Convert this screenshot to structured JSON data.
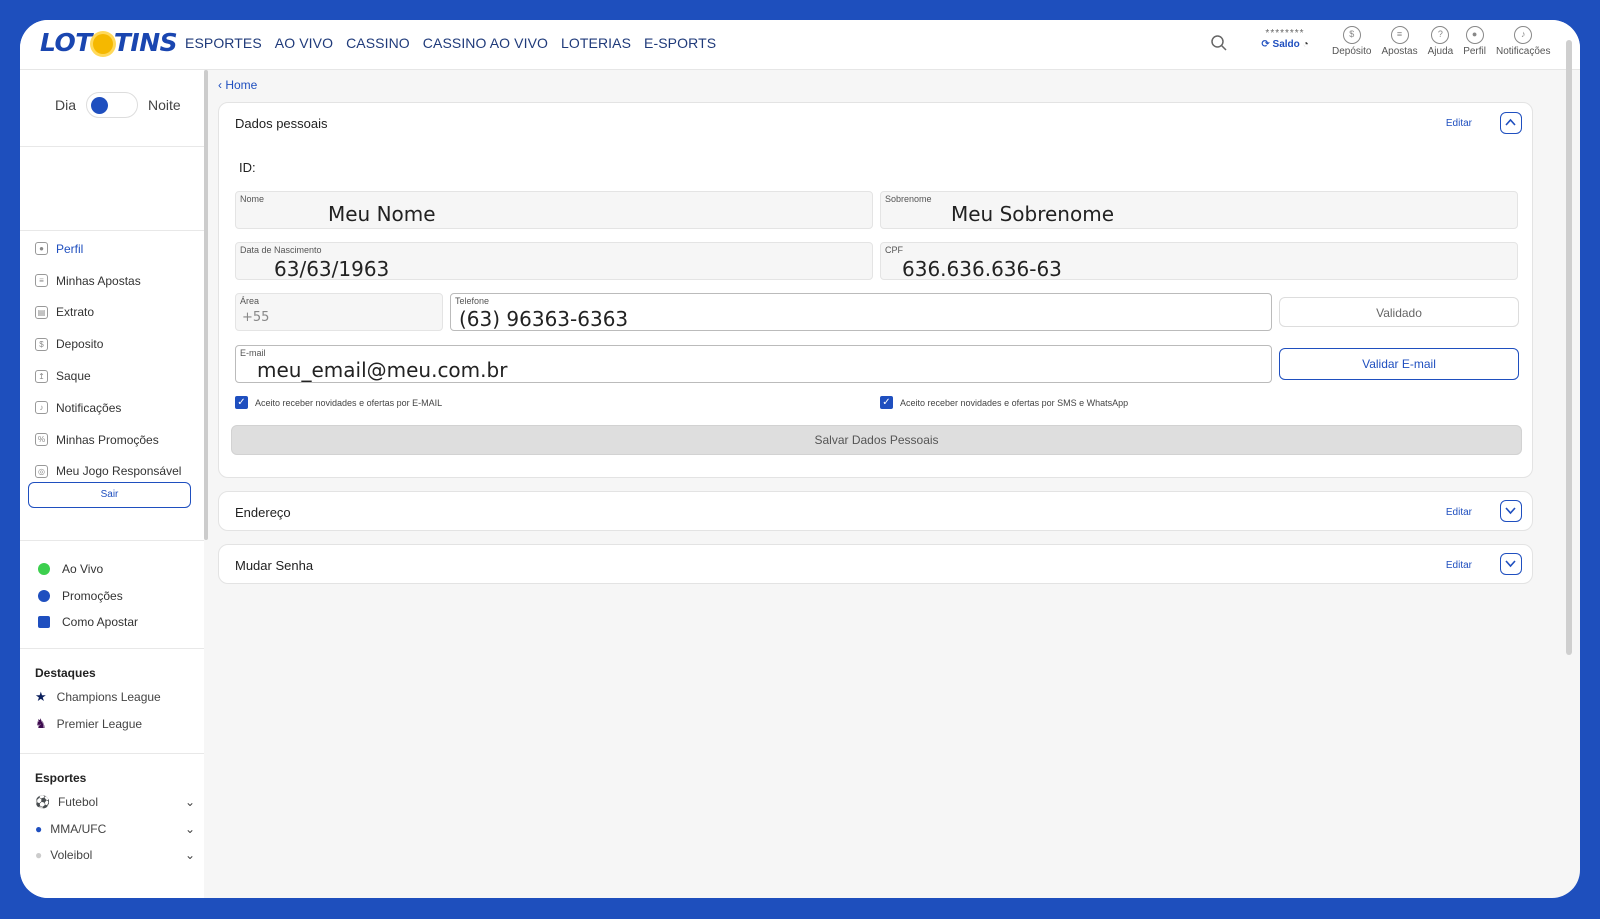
{
  "header": {
    "brand_left": "LOT",
    "brand_right": "TINS",
    "nav": [
      "ESPORTES",
      "AO VIVO",
      "CASSINO",
      "CASSINO AO VIVO",
      "LOTERIAS",
      "E-SPORTS"
    ],
    "balance_mask": "********",
    "balance_label": "Saldo",
    "icons": [
      {
        "label": "Depósito",
        "icon": "deposit-icon"
      },
      {
        "label": "Apostas",
        "icon": "bets-icon"
      },
      {
        "label": "Ajuda",
        "icon": "help-icon"
      },
      {
        "label": "Perfil",
        "icon": "user-icon"
      },
      {
        "label": "Notificações",
        "icon": "bell-icon"
      }
    ]
  },
  "sidebar": {
    "theme_day": "Dia",
    "theme_night": "Noite",
    "menu": [
      {
        "label": "Perfil",
        "active": true
      },
      {
        "label": "Minhas Apostas",
        "active": false
      },
      {
        "label": "Extrato",
        "active": false
      },
      {
        "label": "Deposito",
        "active": false
      },
      {
        "label": "Saque",
        "active": false
      },
      {
        "label": "Notificações",
        "active": false
      },
      {
        "label": "Minhas Promoções",
        "active": false
      },
      {
        "label": "Meu Jogo Responsável",
        "active": false
      }
    ],
    "logout": "Sair",
    "quick": [
      {
        "label": "Ao Vivo",
        "color": "#3ccf4e"
      },
      {
        "label": "Promoções",
        "color": "#1f4fbf"
      },
      {
        "label": "Como Apostar",
        "color": "#1f4fbf"
      }
    ],
    "highlights_title": "Destaques",
    "highlights": [
      {
        "label": "Champions League",
        "color": "#0b1f5c"
      },
      {
        "label": "Premier League",
        "color": "#3d0b4f"
      }
    ],
    "sports_title": "Esportes",
    "sports": [
      {
        "label": "Futebol"
      },
      {
        "label": "MMA/UFC"
      },
      {
        "label": "Voleibol"
      }
    ]
  },
  "breadcrumb": "Home",
  "personal": {
    "title": "Dados pessoais",
    "edit": "Editar",
    "id_label": "ID:",
    "first_name_label": "Nome",
    "first_name": "Meu Nome",
    "last_name_label": "Sobrenome",
    "last_name": "Meu Sobrenome",
    "birth_label": "Data de Nascimento",
    "birth": "63/63/1963",
    "cpf_label": "CPF",
    "cpf": "636.636.636-63",
    "area_label": "Área",
    "area": "+55",
    "phone_label": "Telefone",
    "phone": "(63) 96363-6363",
    "validated": "Validado",
    "email_label": "E-mail",
    "email": "meu_email@meu.com.br",
    "validate_email": "Validar E-mail",
    "optin_email": "Aceito receber novidades e ofertas por E-MAIL",
    "optin_sms": "Aceito receber novidades e ofertas por SMS e WhatsApp",
    "save": "Salvar Dados Pessoais"
  },
  "address": {
    "title": "Endereço",
    "edit": "Editar"
  },
  "password": {
    "title": "Mudar Senha",
    "edit": "Editar"
  },
  "colors": {
    "brand": "#1f4fbf",
    "frame": "#1e4fbd",
    "sun": "#f5b800"
  }
}
